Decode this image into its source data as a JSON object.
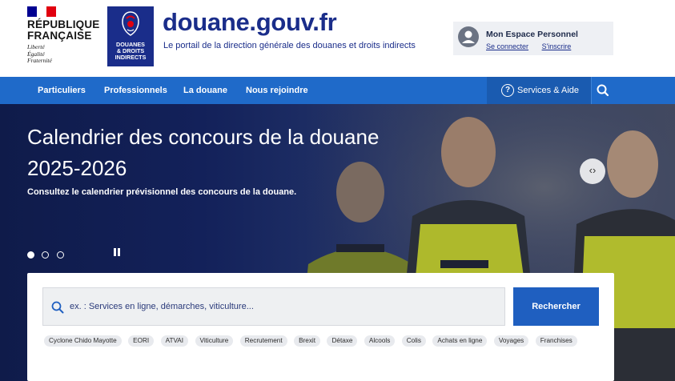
{
  "republique": {
    "title_line1": "RÉPUBLIQUE",
    "title_line2": "FRANÇAISE",
    "motto": [
      "Liberté",
      "Égalité",
      "Fraternité"
    ],
    "flag_colors": [
      "#000091",
      "#ffffff",
      "#e1000f"
    ]
  },
  "dgddi_logo": {
    "line1": "DOUANES",
    "line2": "& DROITS",
    "line3": "INDIRECTS"
  },
  "site": {
    "title": "douane.gouv.fr",
    "tagline": "Le portail de la direction générale des douanes et droits indirects",
    "brand_color": "#1a2d8a"
  },
  "espace": {
    "title": "Mon Espace Personnel",
    "login": "Se connecter",
    "signup": "S'inscrire",
    "icon": "user-icon"
  },
  "nav": {
    "items": [
      "Particuliers",
      "Professionnels",
      "La douane",
      "Nous rejoindre"
    ],
    "services": "Services & Aide",
    "services_icon": "question-icon",
    "search_icon": "search-icon",
    "bar_color": "#1f6ac9"
  },
  "hero": {
    "title_line1": "Calendrier des concours de la douane",
    "title_line2": "2025-2026",
    "subtitle": "Consultez le calendrier prévisionnel des concours de la douane.",
    "slides": 3,
    "active_slide": 1
  },
  "search": {
    "placeholder": "ex. : Services en ligne, démarches, viticulture...",
    "button": "Rechercher",
    "tags": [
      "Cyclone Chido Mayotte",
      "EORI",
      "ATVAI",
      "Viticulture",
      "Recrutement",
      "Brexit",
      "Détaxe",
      "Alcools",
      "Colis",
      "Achats en ligne",
      "Voyages",
      "Franchises"
    ]
  }
}
